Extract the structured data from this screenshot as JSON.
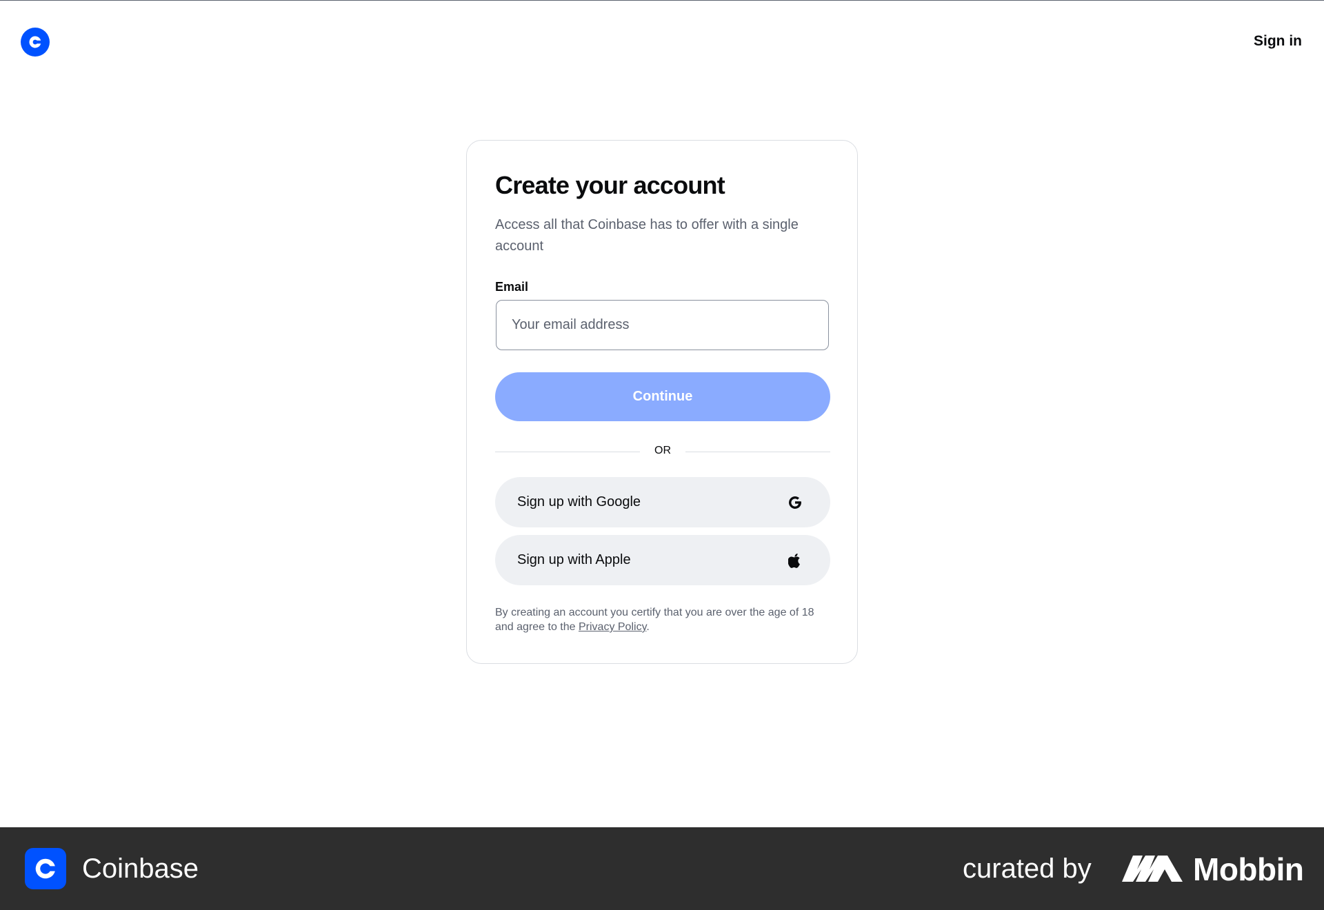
{
  "header": {
    "logo_icon": "coinbase-logo-icon",
    "signin_label": "Sign in"
  },
  "card": {
    "title": "Create your account",
    "subtitle": "Access all that Coinbase has to offer with a single account",
    "email_label": "Email",
    "email_placeholder": "Your email address",
    "email_value": "",
    "continue_label": "Continue",
    "or_label": "OR",
    "google_label": "Sign up with Google",
    "google_icon": "google-icon",
    "apple_label": "Sign up with Apple",
    "apple_icon": "apple-icon",
    "legal_prefix": "By creating an account you certify that you are over the age of 18 and agree to the ",
    "legal_link": "Privacy Policy",
    "legal_suffix": "."
  },
  "footer": {
    "app_name": "Coinbase",
    "app_icon": "coinbase-app-icon",
    "curated_label": "curated by",
    "brand_icon": "mobbin-logo-icon",
    "brand_name": "Mobbin"
  },
  "colors": {
    "brand_blue": "#0052ff",
    "continue_disabled": "#8aabff",
    "social_bg": "#eef0f3",
    "footer_bg": "#2e2e2e"
  }
}
